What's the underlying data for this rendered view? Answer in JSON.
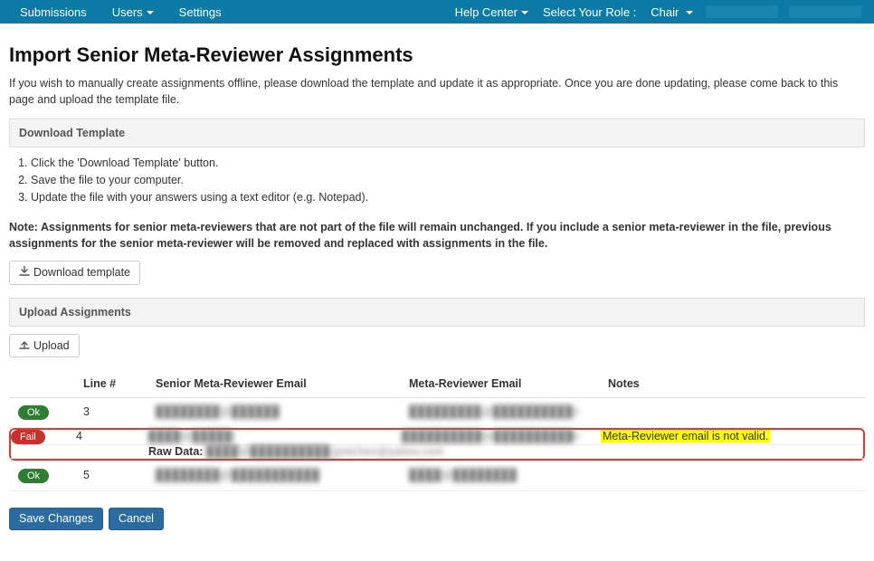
{
  "nav": {
    "left": [
      "Submissions",
      "Users",
      "Settings"
    ],
    "help": "Help Center",
    "role_label": "Select Your Role :",
    "role": "Chair"
  },
  "page": {
    "title": "Import Senior Meta-Reviewer Assignments",
    "intro": "If you wish to manually create assignments offline, please download the template and update it as appropriate. Once you are done updating, please come back to this page and upload the template file.",
    "download_header": "Download Template",
    "steps": [
      "Click the 'Download Template' button.",
      "Save the file to your computer.",
      "Update the file with your answers using a text editor (e.g. Notepad)."
    ],
    "note": "Note: Assignments for senior meta-reviewers that are not part of the file will remain unchanged. If you include a senior meta-reviewer in the file, previous assignments for the senior meta-reviewer will be removed and replaced with assignments in the file.",
    "download_btn": "Download template",
    "upload_header": "Upload Assignments",
    "upload_btn": "Upload",
    "save_btn": "Save Changes",
    "cancel_btn": "Cancel"
  },
  "table": {
    "headers": {
      "line": "Line #",
      "sr": "Senior Meta-Reviewer Email",
      "mr": "Meta-Reviewer Email",
      "notes": "Notes"
    },
    "status_ok": "Ok",
    "status_fail": "Fail",
    "raw_label": "Raw Data:",
    "rows": [
      {
        "status": "ok",
        "line": "3",
        "sr_email": "████████@██████",
        "mr_email": "█████████@██████████n",
        "notes": ""
      },
      {
        "status": "fail",
        "line": "4",
        "sr_email": "████@█████t",
        "mr_email": "██████████@██████████n",
        "notes": "Meta-Reviewer email is not valid.",
        "raw": "████@██████████;gretchen@yahoo.com"
      },
      {
        "status": "ok",
        "line": "5",
        "sr_email": "████████@███████████",
        "mr_email": "████@████████",
        "notes": ""
      }
    ]
  }
}
